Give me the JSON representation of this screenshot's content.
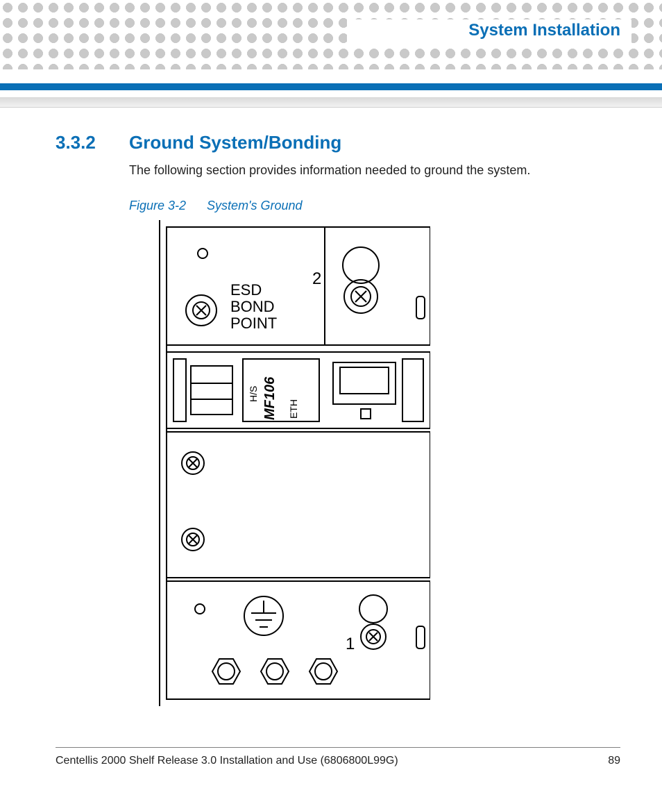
{
  "header": {
    "chapter_title": "System Installation"
  },
  "section": {
    "number": "3.3.2",
    "title": "Ground System/Bonding",
    "intro": "The following section provides information needed to ground the system."
  },
  "figure": {
    "label": "Figure 3-2",
    "title": "System's Ground",
    "callouts": {
      "esd_line1": "ESD",
      "esd_line2": "BOND",
      "esd_line3": "POINT",
      "top_num": "2",
      "bottom_num": "1",
      "module": "MF106",
      "eth": "ETH",
      "hs": "H/S"
    }
  },
  "footer": {
    "doc": "Centellis 2000 Shelf Release 3.0 Installation and Use (6806800L99G)",
    "page": "89"
  }
}
